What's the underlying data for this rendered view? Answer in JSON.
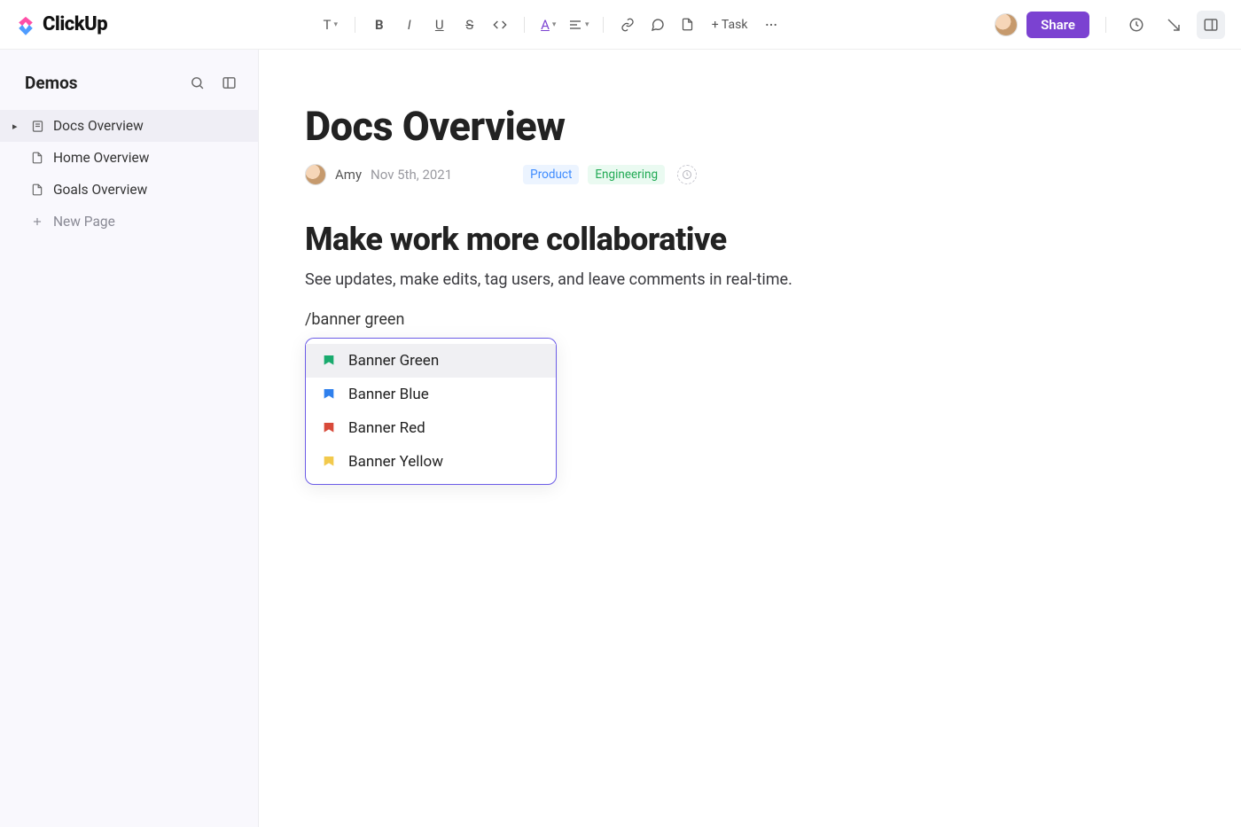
{
  "brand": {
    "name": "ClickUp"
  },
  "topbar": {
    "share_label": "Share",
    "add_task_label": "+ Task"
  },
  "sidebar": {
    "title": "Demos",
    "items": [
      {
        "label": "Docs Overview",
        "active": true
      },
      {
        "label": "Home Overview",
        "active": false
      },
      {
        "label": "Goals Overview",
        "active": false
      }
    ],
    "new_page_label": "New Page"
  },
  "doc": {
    "title": "Docs Overview",
    "author": "Amy",
    "date": "Nov 5th, 2021",
    "tags": {
      "product": "Product",
      "engineering": "Engineering"
    },
    "heading": "Make work more collaborative",
    "paragraph": "See updates, make edits, tag users, and leave comments in real-time.",
    "slash_input": "/banner green"
  },
  "slash_menu": {
    "items": [
      {
        "label": "Banner Green",
        "color": "green",
        "selected": true
      },
      {
        "label": "Banner Blue",
        "color": "blue",
        "selected": false
      },
      {
        "label": "Banner Red",
        "color": "red",
        "selected": false
      },
      {
        "label": "Banner Yellow",
        "color": "yellow",
        "selected": false
      }
    ]
  }
}
